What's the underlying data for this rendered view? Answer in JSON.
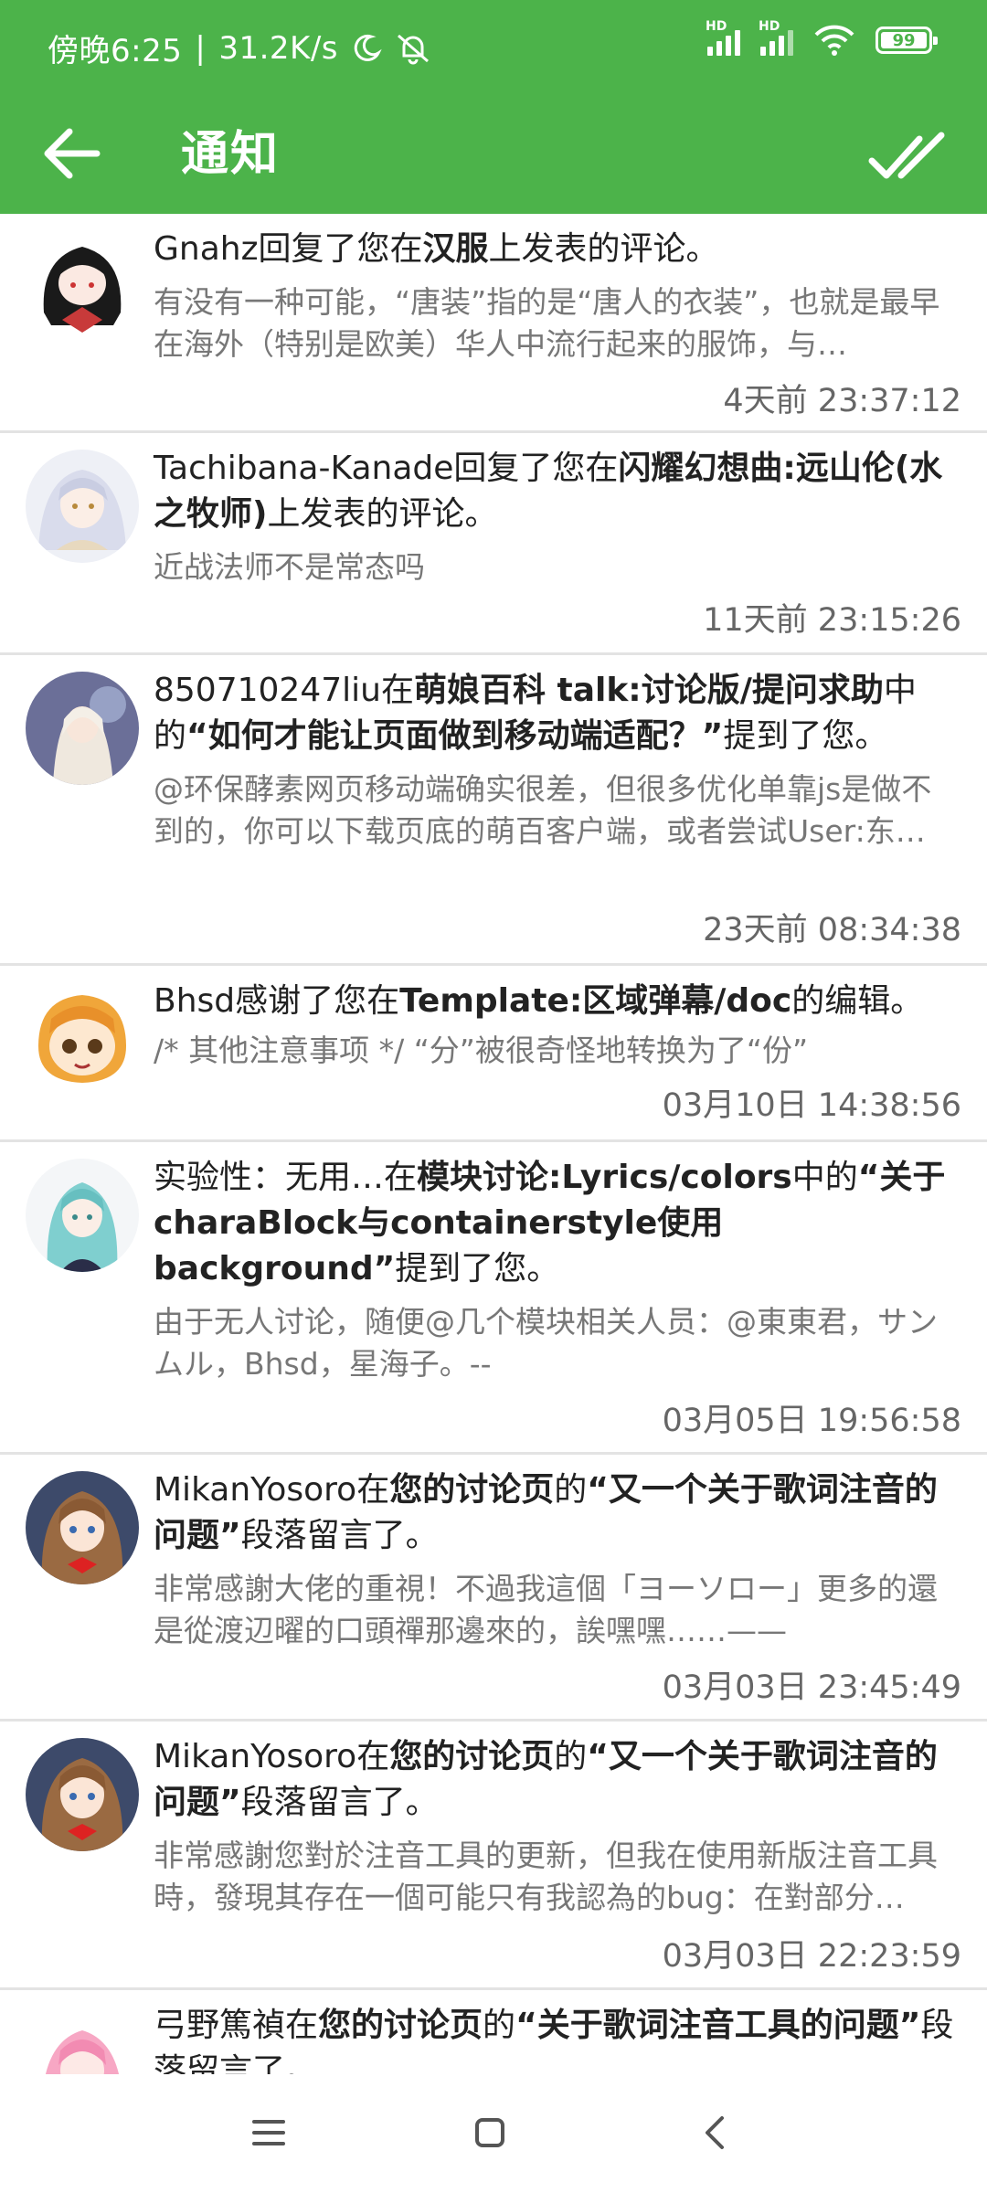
{
  "status": {
    "time": "傍晚6:25",
    "speed": "31.2K/s",
    "battery": "99",
    "hd1": "HD",
    "hd2": "HD"
  },
  "appbar": {
    "title": "通知"
  },
  "notifications": [
    {
      "actor": "Gnahz",
      "pre": "回复了您在",
      "target": "汉服",
      "post": "上发表的评论。",
      "excerpt": "有没有一种可能，“唐装”指的是“唐人的衣装”，也就是最早在海外（特别是欧美）华人中流行起来的服饰，与…",
      "time": "4天前 23:37:12"
    },
    {
      "actor": "Tachibana-Kanade",
      "pre": "回复了您在",
      "target": "闪耀幻想曲:远山伦(水之牧师)",
      "post": "上发表的评论。",
      "excerpt": "近战法师不是常态吗",
      "time": "11天前 23:15:26"
    },
    {
      "actor": "850710247liu",
      "pre": "在",
      "target": "萌娘百科 talk:讨论版/提问求助",
      "post": "中的",
      "quote": "“如何才能让页面做到移动端适配？”",
      "post2": "提到了您。",
      "excerpt": "@环保酵素网页移动端确实很差，但很多优化单靠js是做不到的，你可以下载页底的萌百客户端，或者尝试User:东…",
      "time": "23天前 08:34:38"
    },
    {
      "actor": "Bhsd",
      "pre": "感谢了您在",
      "target": "Template:区域弹幕/doc",
      "post": "的编辑。",
      "excerpt": "/* 其他注意事项 */ “分”被很奇怪地转换为了“份”",
      "time": "03月10日 14:38:56"
    },
    {
      "actor": "实验性：无用…",
      "pre": "在",
      "target": "模块讨论:Lyrics/colors",
      "post": "中的",
      "quote": "“关于charaBlock与containerstyle使用background”",
      "post2": "提到了您。",
      "excerpt": "由于无人讨论，随便@几个模块相关人员：@東東君，サンムル，Bhsd，星海子。--",
      "time": "03月05日 19:56:58"
    },
    {
      "actor": "MikanYosoro",
      "pre": "在",
      "target": "您的讨论页",
      "post": "的",
      "quote": "“又一个关于歌词注音的问题”",
      "post2": "段落留言了。",
      "excerpt": "非常感謝大佬的重視！不過我這個「ヨーソロー」更多的還是從渡辺曜的口頭禪那邊來的，誒嘿嘿……——",
      "time": "03月03日 23:45:49"
    },
    {
      "actor": "MikanYosoro",
      "pre": "在",
      "target": "您的讨论页",
      "post": "的",
      "quote": "“又一个关于歌词注音的问题”",
      "post2": "段落留言了。",
      "excerpt": "非常感謝您對於注音工具的更新，但我在使用新版注音工具時，發現其存在一個可能只有我認為的bug：在對部分…",
      "time": "03月03日 22:23:59"
    },
    {
      "actor": "弓野篤禎",
      "pre": "在",
      "target": "您的讨论页",
      "post": "的",
      "quote": "“关于歌词注音工具的问题”",
      "post2": "段落留言了。",
      "excerpt": "",
      "time": ""
    }
  ],
  "colors": {
    "primary": "#4cb34a",
    "divider": "#e3e3e3"
  },
  "icons": {
    "back": "back-arrow-icon",
    "mark_all_read": "double-check-icon",
    "nav_menu": "menu-icon",
    "nav_home": "home-icon",
    "nav_back": "back-icon"
  }
}
